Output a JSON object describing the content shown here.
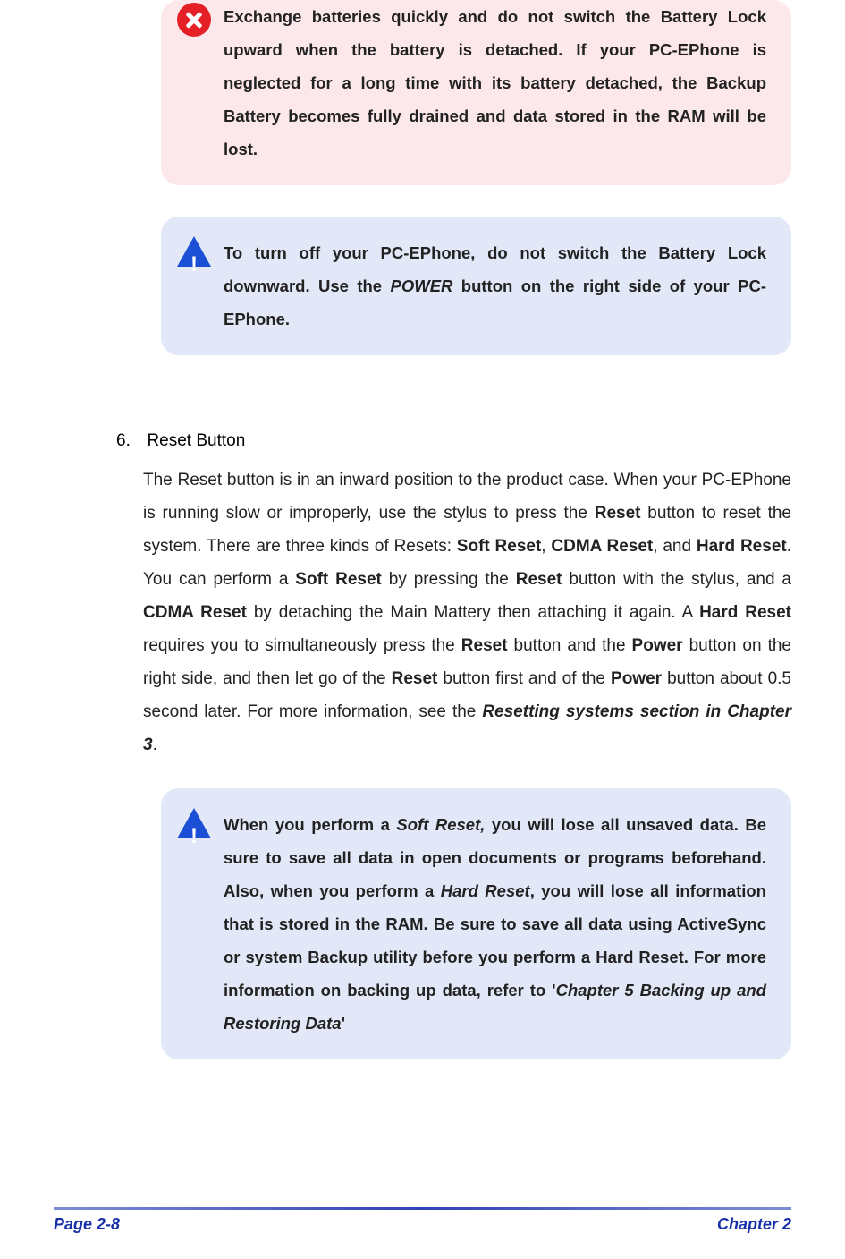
{
  "callouts": {
    "danger1": {
      "text": "Exchange batteries quickly and do not switch the Battery Lock upward when the battery is detached. If your PC-EPhone is neglected for a long time with its battery detached, the Backup Battery becomes fully drained and data stored in the RAM will be lost."
    },
    "info1": {
      "prefix": "To turn off your PC-EPhone, do not switch the Battery Lock downward. Use the ",
      "em1": "POWER",
      "suffix": " button on the right side of your PC-EPhone."
    },
    "info2": {
      "p1": "When you perform a ",
      "em1": "Soft Reset,",
      "p2": " you will lose all unsaved data. Be sure to save all data in open documents or programs beforehand. Also, when you perform a ",
      "em2": "Hard Reset",
      "p3": ", you will lose all information that is stored in the RAM. Be sure to save all data using ActiveSync or system Backup utility before you perform a Hard Reset. For more information on backing up data, refer to '",
      "em3": "Chapter 5 Backing up and Restoring Data",
      "p4": "'"
    }
  },
  "section": {
    "num": "6.",
    "title": "Reset Button",
    "body": {
      "t1": "The Reset button is in an inward position to the product case. When your PC-EPhone is running slow or improperly, use the stylus to press the ",
      "b1": "Reset",
      "t2": " button to reset the system. There are three kinds of Resets: ",
      "b2": "Soft Reset",
      "t3": ", ",
      "b3": "CDMA Reset",
      "t4": ", and ",
      "b4": "Hard Reset",
      "t5": ". You can perform a ",
      "b5": "Soft Reset",
      "t6": " by pressing the ",
      "b6": "Reset",
      "t7": " button with the stylus, and a ",
      "b7": "CDMA Reset",
      "t8": " by detaching the Main Mattery then attaching it again. A ",
      "b8": "Hard Reset",
      "t9": " requires you to simultaneously press the ",
      "b9": "Reset",
      "t10": " button and the ",
      "b10": "Power",
      "t11": " button on the right side, and then let go of the ",
      "b11": "Reset",
      "t12": " button first and of the ",
      "b12": "Power",
      "t13": " button about 0.5 second later. For more information, see the ",
      "bi1": "Resetting systems section in Chapter 3",
      "t14": "."
    }
  },
  "footer": {
    "left": "Page 2-8",
    "right": "Chapter 2"
  }
}
